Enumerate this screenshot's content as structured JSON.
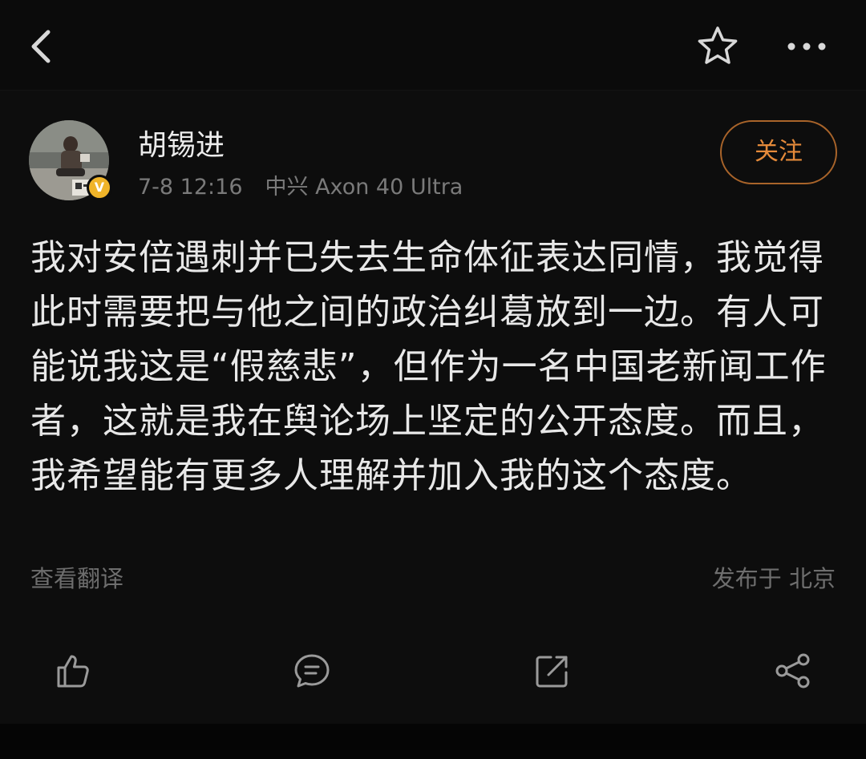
{
  "header": {
    "back_icon": "chevron-left-icon",
    "favorite_icon": "star-outline-icon",
    "more_icon": "more-horizontal-icon"
  },
  "post": {
    "author": {
      "name": "胡锡进",
      "verified": true,
      "verified_badge_letter": "V",
      "badge_color": "#f0b429"
    },
    "timestamp": "7-8 12:16",
    "device": "中兴 Axon 40 Ultra",
    "follow_label": "关注",
    "follow_color": "#e58a3a",
    "content": "我对安倍遇刺并已失去生命体征表达同情，我觉得此时需要把与他之间的政治纠葛放到一边。有人可能说我这是“假慈悲”，但作为一名中国老新闻工作者，这就是我在舆论场上坚定的公开态度。而且，我希望能有更多人理解并加入我的这个态度。",
    "translate_label": "查看翻译",
    "location_label": "发布于 北京"
  },
  "actions": [
    {
      "name": "like",
      "icon": "thumbs-up-icon"
    },
    {
      "name": "comment",
      "icon": "comment-icon"
    },
    {
      "name": "repost",
      "icon": "repost-icon"
    },
    {
      "name": "share",
      "icon": "share-icon"
    }
  ],
  "colors": {
    "background": "#0d0d0d",
    "text_primary": "#e8e8e8",
    "text_secondary": "#7a7a7a",
    "accent": "#e58a3a"
  }
}
